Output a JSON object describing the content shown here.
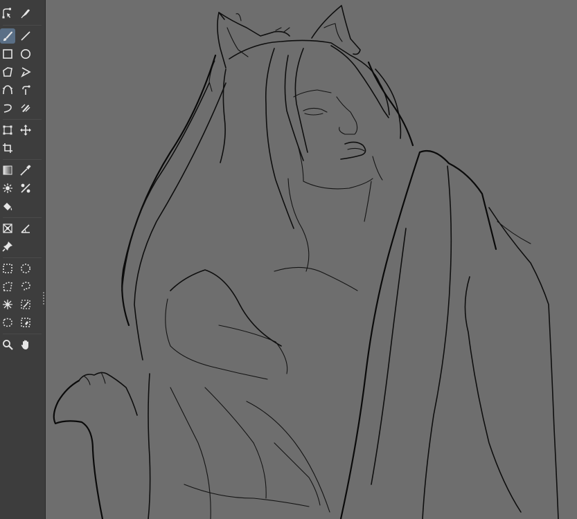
{
  "app": {
    "ui_colors": {
      "toolbox_bg": "#3d3d3d",
      "canvas_bg": "#6e6e6e",
      "active_tool": "#5a6f86",
      "icon": "#e6e6e6",
      "lineart": "#0e0e0e"
    }
  },
  "toolbox": {
    "active_tool": "freehand-brush",
    "tools": [
      "bezier-edit-icon",
      "calligraphy-pen-icon",
      "freehand-brush-icon",
      "line-icon",
      "rectangle-icon",
      "ellipse-icon",
      "polygon-icon",
      "polyline-icon",
      "bezier-curve-icon",
      "dynamic-brush-icon",
      "lasso-stroke-icon",
      "multibrush-icon",
      "transform-icon",
      "move-icon",
      "crop-icon",
      "gradient-icon",
      "color-picker-icon",
      "smart-patch-icon",
      "enclose-fill-icon",
      "fill-bucket-icon",
      "assistant-icon",
      "measure-icon",
      "reference-pin-icon",
      "rect-select-icon",
      "ellipse-select-icon",
      "poly-select-icon",
      "freehand-select-icon",
      "contiguous-select-icon",
      "similar-select-icon",
      "bezier-select-icon",
      "magnetic-select-icon",
      "zoom-icon",
      "pan-icon"
    ]
  },
  "canvas": {
    "content": "lineart-illustration"
  }
}
